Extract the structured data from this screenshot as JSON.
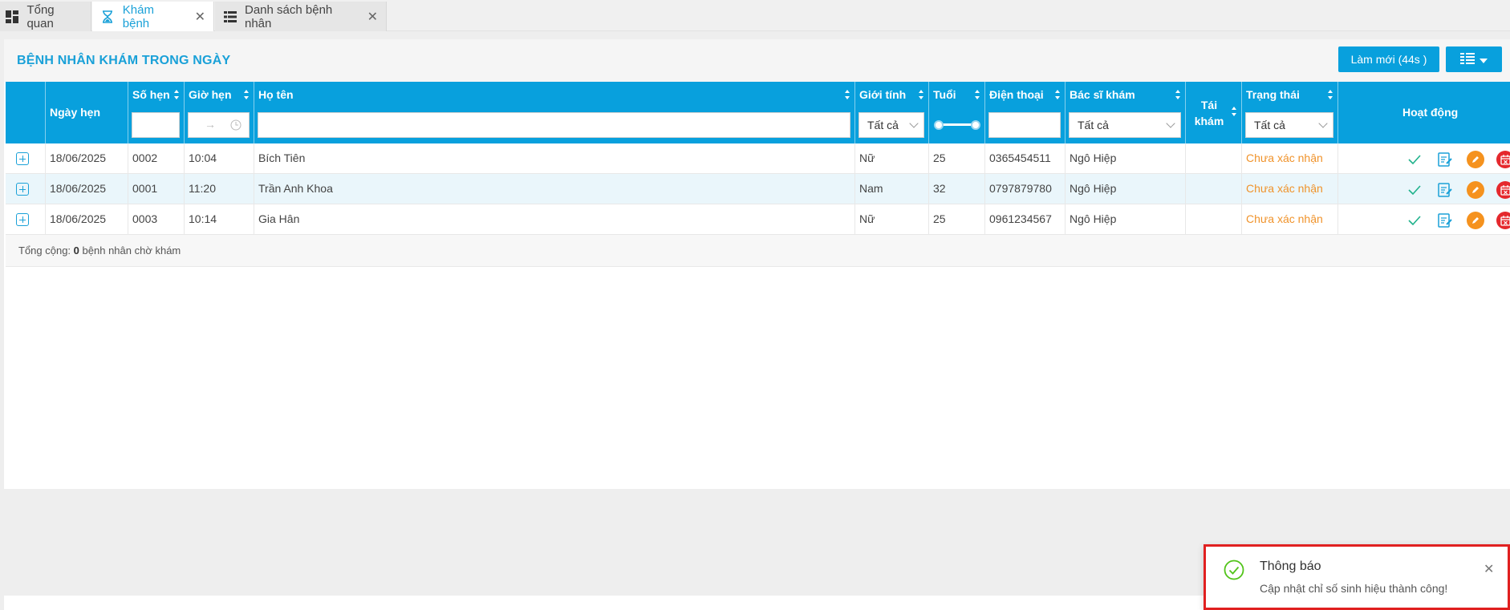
{
  "tabs": [
    {
      "label": "Tổng quan",
      "icon": "dashboard-icon",
      "closable": false,
      "active": false
    },
    {
      "label": "Khám bệnh",
      "icon": "hourglass-icon",
      "closable": true,
      "active": true
    },
    {
      "label": "Danh sách bệnh nhân",
      "icon": "list-icon",
      "closable": true,
      "active": false
    }
  ],
  "header": {
    "title": "BỆNH NHÂN KHÁM TRONG NGÀY",
    "refresh_label": "Làm mới (44s )",
    "columns_icon": "column-settings-icon"
  },
  "columns": {
    "date": "Ngày hẹn",
    "number": "Số hẹn",
    "time": "Giờ hẹn",
    "name": "Họ tên",
    "gender": "Giới tính",
    "age": "Tuổi",
    "phone": "Điện thoại",
    "doctor": "Bác sĩ khám",
    "revisit": "Tái khám",
    "status": "Trạng thái",
    "actions": "Hoạt động"
  },
  "filters": {
    "gender": "Tất cả",
    "doctor": "Tất cả",
    "status": "Tất cả"
  },
  "rows": [
    {
      "date": "18/06/2025",
      "number": "0002",
      "time": "10:04",
      "name": "Bích Tiên",
      "gender": "Nữ",
      "age": "25",
      "phone": "0365454511",
      "doctor": "Ngô Hiệp",
      "revisit": "",
      "status": "Chưa xác nhận"
    },
    {
      "date": "18/06/2025",
      "number": "0001",
      "time": "11:20",
      "name": "Trần Anh Khoa",
      "gender": "Nam",
      "age": "32",
      "phone": "0797879780",
      "doctor": "Ngô Hiệp",
      "revisit": "",
      "status": "Chưa xác nhận"
    },
    {
      "date": "18/06/2025",
      "number": "0003",
      "time": "10:14",
      "name": "Gia Hân",
      "gender": "Nữ",
      "age": "25",
      "phone": "0961234567",
      "doctor": "Ngô Hiệp",
      "revisit": "",
      "status": "Chưa xác nhận"
    }
  ],
  "footer": {
    "prefix": "Tổng cộng:",
    "count": "0",
    "suffix": "bệnh nhân chờ khám"
  },
  "notification": {
    "title": "Thông báo",
    "message": "Cập nhật chỉ số sinh hiệu thành công!"
  },
  "colors": {
    "primary": "#08a0dd",
    "status_pending": "#f0932b",
    "confirm": "#20b28c",
    "edit": "#f5921e",
    "cancel": "#e5282d",
    "highlight_border": "#e02020"
  }
}
